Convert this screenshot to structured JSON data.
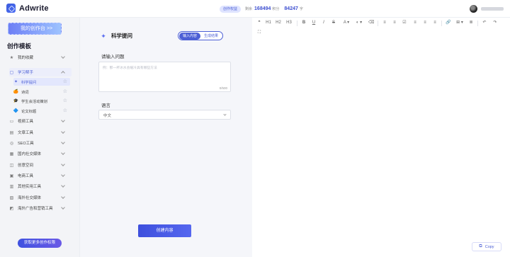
{
  "app": {
    "name": "Adwrite"
  },
  "header": {
    "badge": "创作权益",
    "points_label": "剩余",
    "points_value": "168494",
    "points_unit": "积分",
    "chars_value": "84247",
    "chars_unit": "字"
  },
  "sidebar": {
    "my_works": "我的创作台 >>",
    "title": "创作模板",
    "favorites": "我的收藏",
    "study": "学习帮手",
    "sub": [
      {
        "label": "科学提问",
        "icon": "✦"
      },
      {
        "label": "诗词",
        "icon": "🍊"
      },
      {
        "label": "学生会活动策划",
        "icon": "🎓"
      },
      {
        "label": "论文标题",
        "icon": "🔷"
      }
    ],
    "groups": [
      {
        "label": "视频工具",
        "icon": "▭"
      },
      {
        "label": "文章工具",
        "icon": "▤"
      },
      {
        "label": "SEO工具",
        "icon": "◎"
      },
      {
        "label": "国内社交媒体",
        "icon": "▦"
      },
      {
        "label": "创意空间",
        "icon": "◫"
      },
      {
        "label": "电商工具",
        "icon": "▣"
      },
      {
        "label": "其他实用工具",
        "icon": "▥"
      },
      {
        "label": "海外社交媒体",
        "icon": "▧"
      },
      {
        "label": "海外广告和营销工具",
        "icon": "◩"
      }
    ],
    "get_more": "获取更多创作权限"
  },
  "form": {
    "tool_name": "科学提问",
    "tab_input": "输入内容",
    "tab_result": "生成结果",
    "question_label": "请输入问题",
    "question_placeholder": "例：那一杯冰水会缓冷具有哪些方法",
    "question_count": "0/500",
    "language_label": "语言",
    "language_value": "中文",
    "create_button": "创建内容"
  },
  "editor": {
    "toolbar": [
      "❝",
      "H1",
      "H2",
      "H3",
      "B",
      "U",
      "I",
      "S",
      "A ▾",
      "◐ ▾",
      "≡",
      "≡",
      "☑",
      "≡",
      "≡",
      "≡",
      "🔗",
      "⊞ ▾",
      "≣",
      "↶",
      "↷",
      "⛶"
    ],
    "copy_label": "Copy"
  }
}
